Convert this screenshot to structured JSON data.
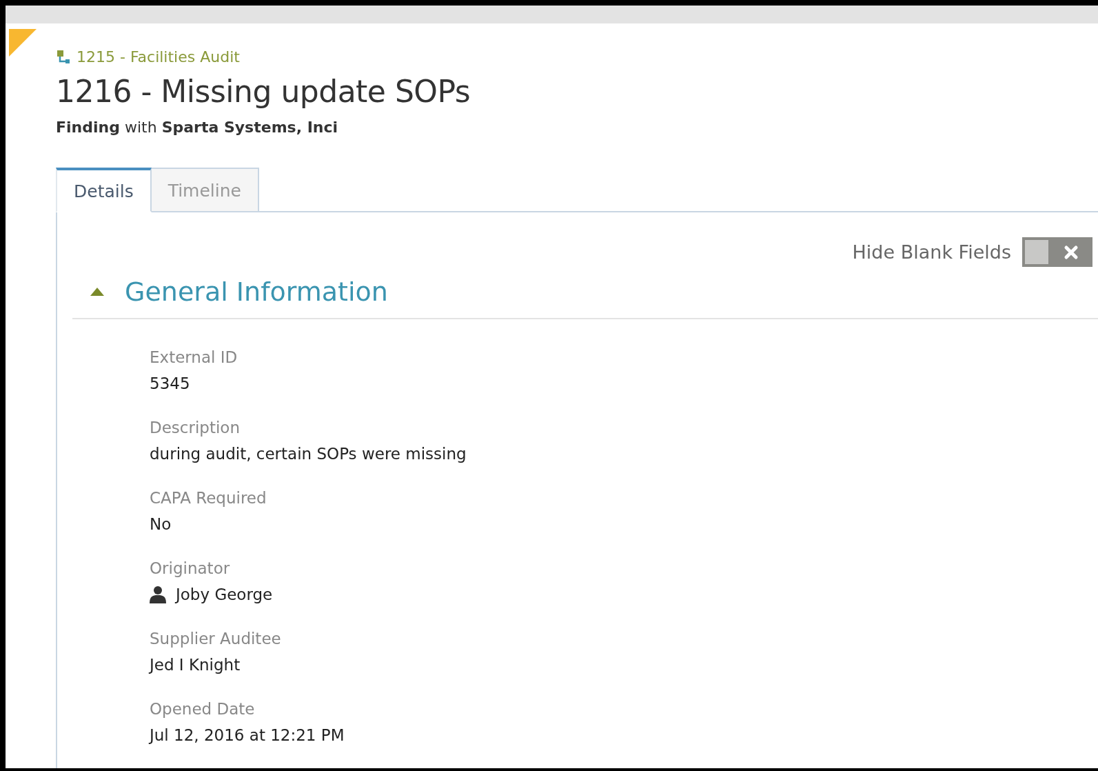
{
  "breadcrumb": {
    "label": "1215 - Facilities Audit"
  },
  "title": "1216 - Missing update SOPs",
  "subtitle": {
    "type": "Finding",
    "connector": "with",
    "company": "Sparta Systems, Inci"
  },
  "tabs": [
    {
      "label": "Details",
      "selected": true
    },
    {
      "label": "Timeline",
      "selected": false
    }
  ],
  "hide_blank_fields": {
    "label": "Hide Blank Fields",
    "on": false
  },
  "section": {
    "title": "General Information",
    "expanded": true,
    "fields": [
      {
        "label": "External ID",
        "value": "5345",
        "kind": "text"
      },
      {
        "label": "Description",
        "value": "during audit, certain SOPs were missing",
        "kind": "text"
      },
      {
        "label": "CAPA Required",
        "value": "No",
        "kind": "text"
      },
      {
        "label": "Originator",
        "value": "Joby George",
        "kind": "person"
      },
      {
        "label": "Supplier Auditee",
        "value": "Jed I Knight",
        "kind": "text"
      },
      {
        "label": "Opened Date",
        "value": "Jul 12, 2016 at 12:21 PM",
        "kind": "text"
      }
    ]
  }
}
